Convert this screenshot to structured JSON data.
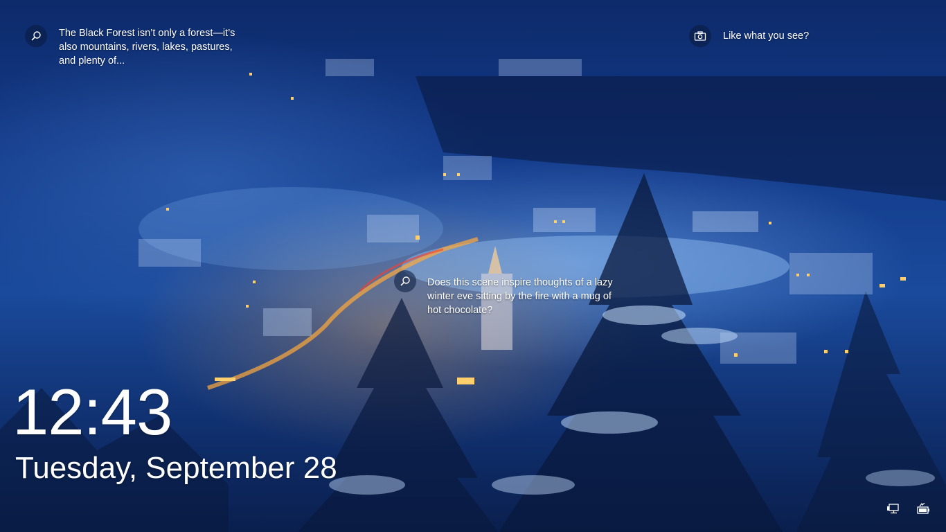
{
  "spotlight": {
    "items": [
      {
        "icon": "search-icon",
        "text": "The Black Forest isn’t only a forest—it’s also mountains, rivers, lakes, pastures, and plenty of..."
      },
      {
        "icon": "camera-icon",
        "text": "Like what you see?"
      },
      {
        "icon": "search-icon",
        "text": "Does this scene inspire thoughts of a lazy winter eve sitting by the fire with a mug of hot chocolate?"
      }
    ]
  },
  "clock": {
    "time": "12:43",
    "date": "Tuesday, September 28"
  },
  "tray": {
    "icons": [
      "network-icon",
      "battery-icon"
    ]
  },
  "colors": {
    "sky_top": "#0d2a6a",
    "scene_blue": "#1a4a9c",
    "warm_light": "#ffcf6e",
    "text": "#ffffff"
  }
}
